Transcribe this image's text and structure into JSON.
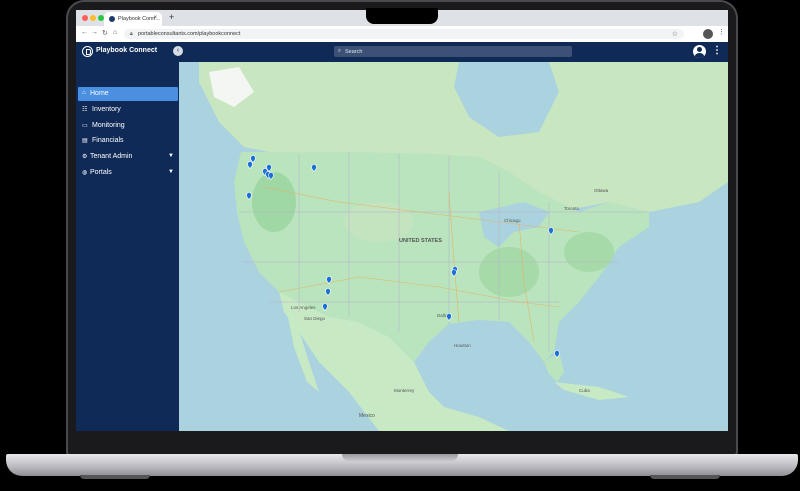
{
  "browser": {
    "tab_title": "Playbook Conn...",
    "tab_close": "×",
    "new_tab": "+",
    "url": "portableconsultants.com/playbookconnect",
    "icons": [
      "back-icon",
      "forward-icon",
      "reload-icon",
      "home-icon",
      "lock-icon",
      "star-icon"
    ]
  },
  "app": {
    "brand": "Playbook Connect",
    "search_placeholder": "Search",
    "collapse_glyph": "‹"
  },
  "sidebar": {
    "items": [
      {
        "label": "Home",
        "icon": "home-icon",
        "active": true
      },
      {
        "label": "Inventory",
        "icon": "inventory-icon"
      },
      {
        "label": "Monitoring",
        "icon": "monitor-icon"
      },
      {
        "label": "Financials",
        "icon": "financials-icon"
      },
      {
        "label": "Tenant Admin",
        "icon": "gear-icon",
        "has_submenu": true
      },
      {
        "label": "Portals",
        "icon": "globe-icon",
        "has_submenu": true
      }
    ]
  },
  "map": {
    "labels": {
      "country": "UNITED STATES",
      "cities": [
        "Los Angeles",
        "San Diego",
        "Dallas",
        "Houston",
        "Chicago",
        "Toronto",
        "Ottawa",
        "Monterrey",
        "Mexico",
        "Cuba"
      ]
    },
    "marker_count": 16,
    "colors": {
      "ocean": "#aad3df",
      "land": "#b9e4bd",
      "forest": "#9fd8a4",
      "marker": "#1c6fd6"
    }
  },
  "colors": {
    "navy": "#0f2a57",
    "active": "#4a8fe0"
  }
}
